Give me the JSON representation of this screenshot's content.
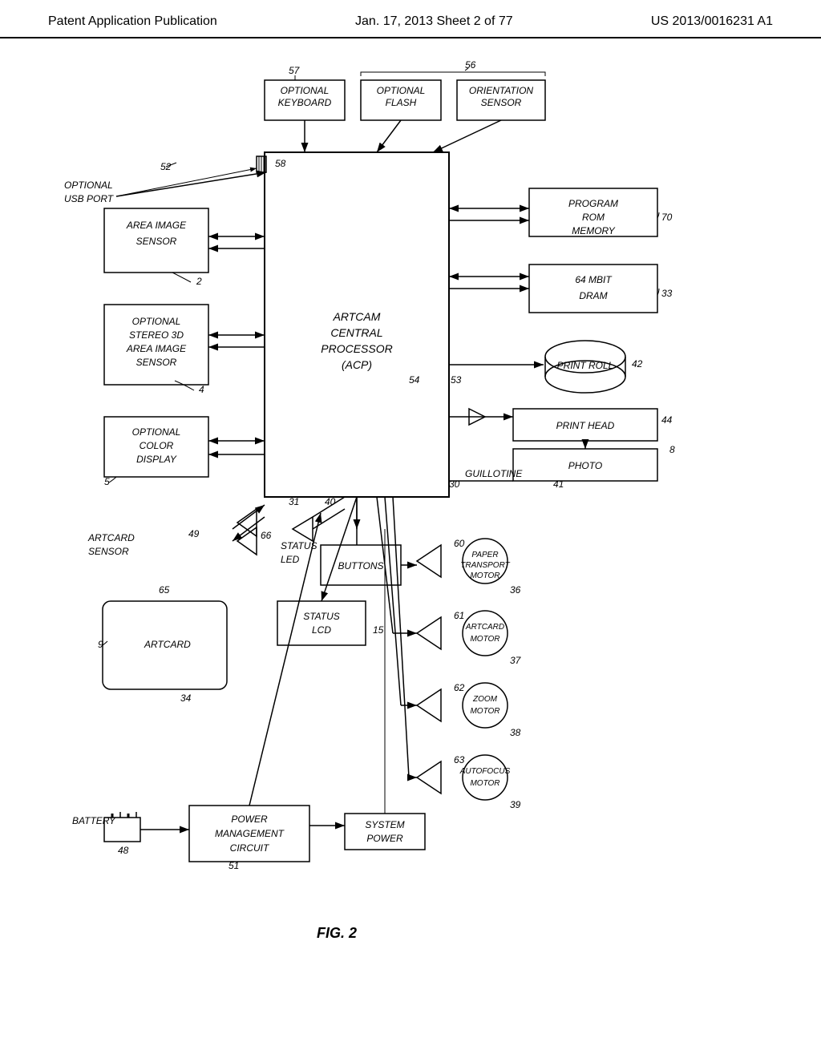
{
  "header": {
    "left": "Patent Application Publication",
    "center": "Jan. 17, 2013   Sheet 2 of 77",
    "right": "US 2013/0016231 A1"
  },
  "diagram": {
    "title": "FIG. 2",
    "components": {
      "area_image_sensor": "AREA IMAGE SENSOR",
      "optional_stereo": "OPTIONAL STEREO 3D AREA IMAGE SENSOR",
      "optional_color_display": "OPTIONAL COLOR DISPLAY",
      "optional_usb_port": "OPTIONAL USB PORT",
      "optional_keyboard": "OPTIONAL KEYBOARD",
      "optional_flash": "OPTIONAL FLASH",
      "orientation_sensor": "ORIENTATION SENSOR",
      "artcam_cpu": "ARTCAM CENTRAL PROCESSOR (ACP)",
      "program_rom": "PROGRAM ROM MEMORY",
      "dram": "64 MBIT DRAM",
      "print_roll": "PRINT ROLL",
      "print_head": "PRINT HEAD",
      "photo": "PHOTO",
      "guillotine": "GUILLOTINE",
      "artcard_sensor": "ARTCARD SENSOR",
      "status_led": "STATUS LED",
      "buttons": "BUTTONS",
      "artcard": "ARTCARD",
      "status_lcd": "STATUS LCD",
      "paper_transport_motor": "PAPER TRANSPORT MOTOR",
      "artcard_motor": "ARTCARD MOTOR",
      "zoom_motor": "ZOOM MOTOR",
      "autofocus_motor": "AUTOFOCUS MOTOR",
      "battery": "BATTERY",
      "power_management": "POWER MANAGEMENT CIRCUIT",
      "system_power": "SYSTEM POWER"
    },
    "ref_numbers": {
      "n2": "2",
      "n4": "4",
      "n5": "5",
      "n8": "8",
      "n9": "9",
      "n15": "15",
      "n30": "30",
      "n31": "31",
      "n33": "33",
      "n34": "34",
      "n36": "36",
      "n37": "37",
      "n38": "38",
      "n39": "39",
      "n40": "40",
      "n41": "41",
      "n42": "42",
      "n44": "44",
      "n48": "48",
      "n49": "49",
      "n51": "51",
      "n52": "52",
      "n53": "53",
      "n54": "54",
      "n56": "56",
      "n57": "57",
      "n58": "58",
      "n60": "60",
      "n61": "61",
      "n62": "62",
      "n63": "63",
      "n65": "65",
      "n66": "66",
      "n70": "70"
    }
  }
}
